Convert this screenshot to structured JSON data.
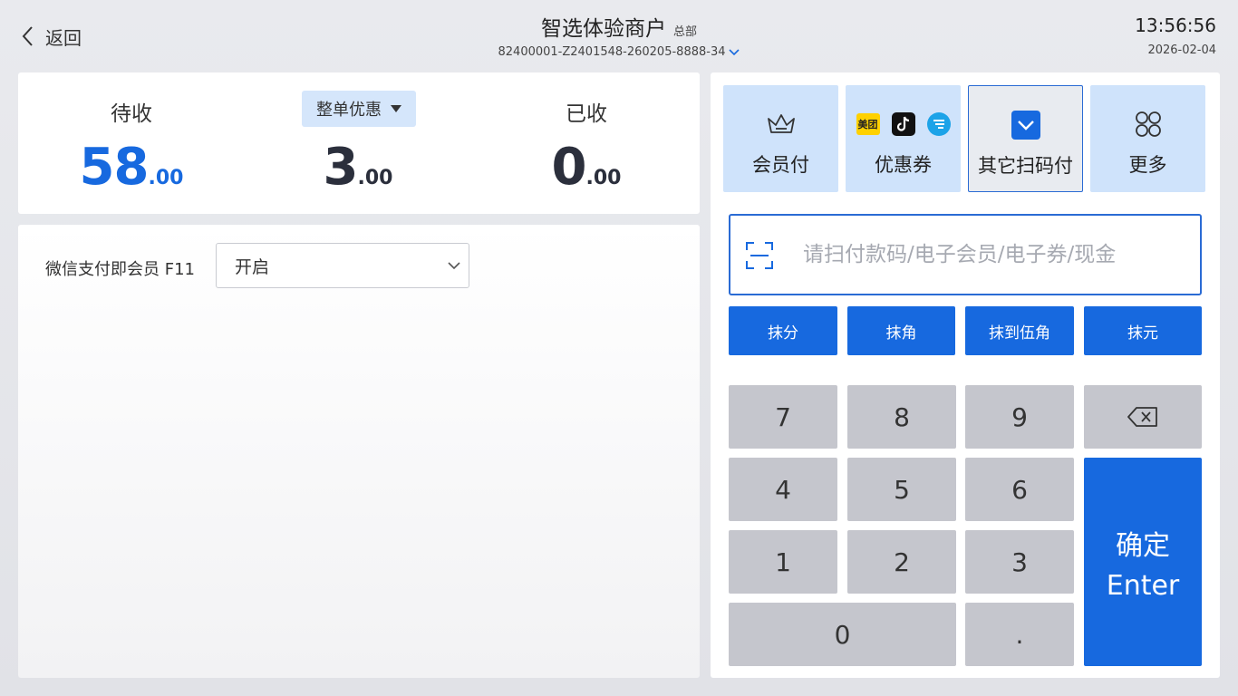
{
  "header": {
    "back_label": "返回",
    "store_name": "智选体验商户",
    "store_tag": "总部",
    "order_id": "82400001-Z2401548-260205-8888-34",
    "time": "13:56:56",
    "date": "2026-02-04"
  },
  "summary": {
    "pending_label": "待收",
    "pending_int": "58",
    "pending_dec": ".00",
    "discount_label": "整单优惠",
    "discount_int": "3",
    "discount_dec": ".00",
    "received_label": "已收",
    "received_int": "0",
    "received_dec": ".00"
  },
  "settings": {
    "wechat_member_label": "微信支付即会员 F11",
    "wechat_member_value": "开启"
  },
  "payment_tabs": [
    {
      "label": "会员付",
      "icon": "crown-icon"
    },
    {
      "label": "优惠券",
      "icon": "brand-logos-icon"
    },
    {
      "label": "其它扫码付",
      "icon": "check-icon",
      "active": true
    },
    {
      "label": "更多",
      "icon": "grid-icon"
    }
  ],
  "scan": {
    "placeholder": "请扫付款码/电子会员/电子券/现金"
  },
  "rounding": [
    "抹分",
    "抹角",
    "抹到伍角",
    "抹元"
  ],
  "keypad": {
    "k7": "7",
    "k8": "8",
    "k9": "9",
    "k4": "4",
    "k5": "5",
    "k6": "6",
    "k1": "1",
    "k2": "2",
    "k3": "3",
    "k0": "0",
    "kdot": ".",
    "enter_line1": "确定",
    "enter_line2": "Enter"
  },
  "brand_badges": {
    "meituan": "美团"
  },
  "colors": {
    "accent": "#1769df",
    "tab_bg": "#cfe3fb",
    "key_bg": "#c5c6cd"
  }
}
